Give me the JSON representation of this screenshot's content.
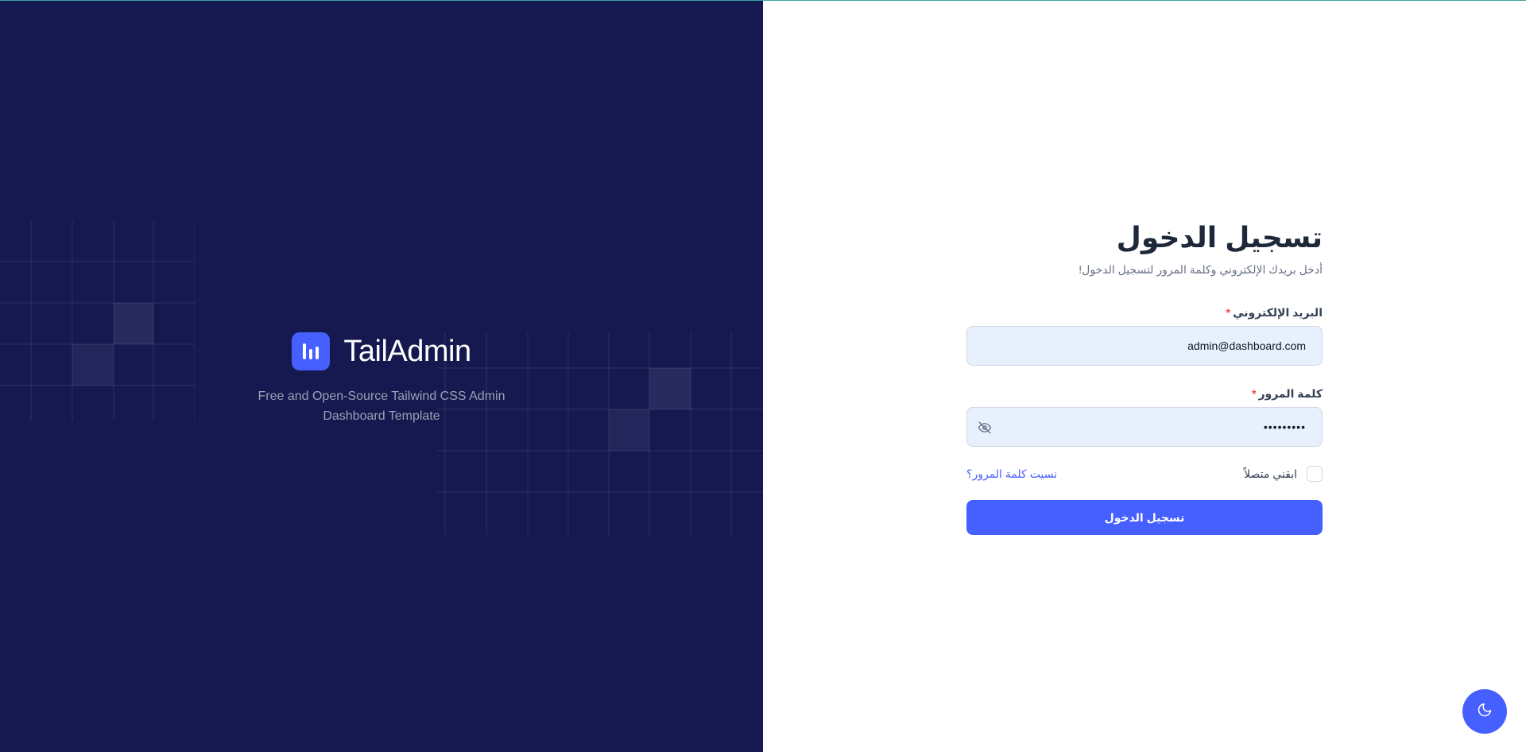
{
  "brand": {
    "name": "TailAdmin",
    "tagline": "Free and Open-Source Tailwind CSS Admin Dashboard Template",
    "logo_icon": "bar-chart-logo-icon"
  },
  "login": {
    "title": "تسجيل الدخول",
    "subtitle": "أدخل بريدك الإلكتروني وكلمة المرور لتسجيل الدخول!",
    "email_label": "البريد الإلكتروني",
    "email_value": "admin@dashboard.com",
    "password_label": "كلمة المرور",
    "password_value": "•••••••••",
    "required_mark": "*",
    "remember_label": "ابقني متصلاً",
    "forgot_label": "نسيت كلمة المرور؟",
    "submit_label": "تسجيل الدخول"
  },
  "icons": {
    "password_toggle": "eye-off-icon",
    "theme_toggle": "moon-icon"
  },
  "colors": {
    "brand_panel_bg": "#161950",
    "accent": "#465fff",
    "input_bg": "#e8f0fe",
    "required": "#f04438"
  }
}
